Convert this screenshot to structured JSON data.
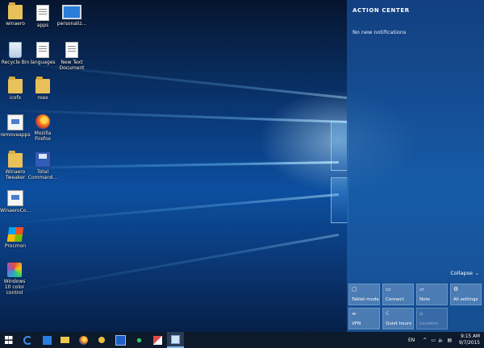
{
  "desktop": {
    "icons": [
      {
        "label": "winaero",
        "icon": "user-folder-icon"
      },
      {
        "label": "apps",
        "icon": "document-icon"
      },
      {
        "label": "personaliz...",
        "icon": "monitor-icon"
      },
      {
        "label": "Recycle Bin",
        "icon": "recycle-bin-icon"
      },
      {
        "label": "languages",
        "icon": "document-icon"
      },
      {
        "label": "New Text Document",
        "icon": "text-document-icon"
      },
      {
        "label": "icofx",
        "icon": "folder-icon"
      },
      {
        "label": "roex",
        "icon": "folder-icon"
      },
      {
        "label": "removeapps",
        "icon": "app-icon"
      },
      {
        "label": "Mozilla Firefox",
        "icon": "firefox-icon"
      },
      {
        "label": "Winaero Tweaker",
        "icon": "folder-icon"
      },
      {
        "label": "Total Command...",
        "icon": "floppy-icon"
      },
      {
        "label": "WinaeroCo...",
        "icon": "tool-icon"
      },
      {
        "label": "Procmon",
        "icon": "windows-logo-icon"
      },
      {
        "label": "Windows 10 color control",
        "icon": "color-control-icon"
      }
    ]
  },
  "action_center": {
    "title": "ACTION CENTER",
    "empty_text": "No new notifications",
    "collapse_label": "Collapse",
    "tiles": [
      {
        "label": "Tablet mode",
        "icon": "tablet-mode-icon",
        "glyph": "▢"
      },
      {
        "label": "Connect",
        "icon": "connect-icon",
        "glyph": "▭"
      },
      {
        "label": "Note",
        "icon": "note-icon",
        "glyph": "▱"
      },
      {
        "label": "All settings",
        "icon": "settings-gear-icon",
        "glyph": "⚙"
      },
      {
        "label": "VPN",
        "icon": "vpn-icon",
        "glyph": "⌯"
      },
      {
        "label": "Quiet hours",
        "icon": "moon-icon",
        "glyph": "☾"
      },
      {
        "label": "Location",
        "icon": "location-icon",
        "glyph": "⌂",
        "disabled": true
      }
    ]
  },
  "taskbar": {
    "language": "EN",
    "time": "9:15 AM",
    "date": "9/7/2015",
    "tray_glyphs": {
      "chevron": "^",
      "network": "▭",
      "volume": "🔈",
      "action": "▤"
    }
  }
}
